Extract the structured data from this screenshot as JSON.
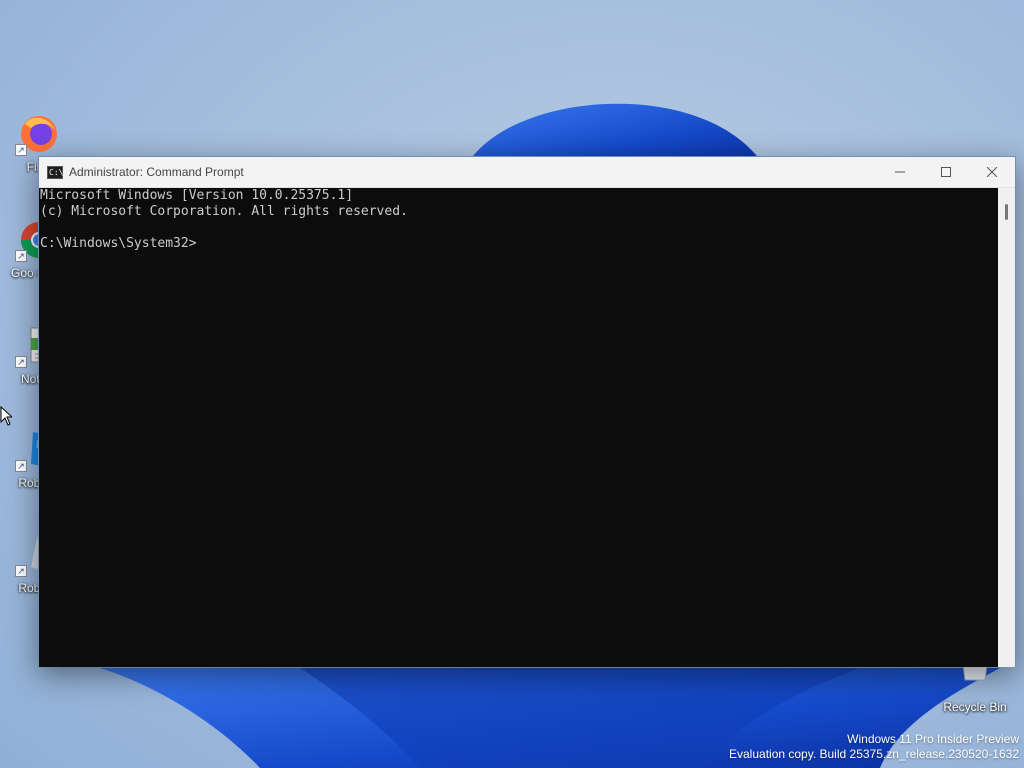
{
  "desktop": {
    "icons": [
      {
        "label": "Fire",
        "icon": "firefox-icon"
      },
      {
        "label": "Goo Chro",
        "icon": "chrome-icon"
      },
      {
        "label": "Notep",
        "icon": "notepad-icon"
      },
      {
        "label": "Roblox",
        "icon": "roblox-player-icon"
      },
      {
        "label": "Roblox",
        "icon": "roblox-studio-icon"
      }
    ],
    "recycle_bin": {
      "label": "Recycle Bin",
      "icon": "recycle-bin-icon"
    }
  },
  "window": {
    "title": "Administrator: Command Prompt",
    "app_icon_text": "C:\\",
    "console": {
      "line1": "Microsoft Windows [Version 10.0.25375.1]",
      "line2": "(c) Microsoft Corporation. All rights reserved.",
      "line3": "",
      "prompt": "C:\\Windows\\System32>"
    }
  },
  "watermark": {
    "line1": "Windows 11 Pro Insider Preview",
    "line2": "Evaluation copy. Build 25375.zn_release.230520-1632"
  },
  "colors": {
    "console_bg": "#0c0c0c",
    "console_text": "#cccccc",
    "wallpaper_blue": "#1e5fd8"
  }
}
